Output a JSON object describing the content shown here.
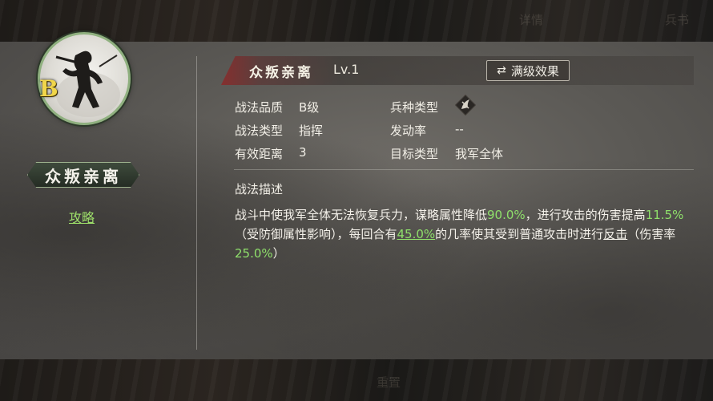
{
  "background": {
    "top_tab_left": "详情",
    "top_tab_right": "兵书",
    "bottom_hint": "重置"
  },
  "left": {
    "grade": "B",
    "skill_name_plate": "众叛亲离",
    "guide_link": "攻略"
  },
  "header": {
    "skill_name": "众叛亲离",
    "level": "Lv.1",
    "max_effect_button": "满级效果",
    "swap_icon": "⇄"
  },
  "attributes": {
    "quality_label": "战法品质",
    "quality_value": "B级",
    "type_label": "战法类型",
    "type_value": "指挥",
    "range_label": "有效距离",
    "range_value": "3",
    "troop_label": "兵种类型",
    "troop_icon": "troop-type-icon",
    "trigger_label": "发动率",
    "trigger_value": "--",
    "target_label": "目标类型",
    "target_value": "我军全体"
  },
  "description": {
    "heading": "战法描述",
    "part1": "战斗中使我军全体无法恢复兵力，谋略属性降低",
    "v1": "90.0%",
    "part2": "，进行攻击的伤害提高",
    "v2": "11.5%",
    "part3": "（受防御属性影响），每回合有",
    "v3": "45.0%",
    "part4": "的几率使其受到普通攻击时进行",
    "link": "反击",
    "part5": "（伤害率",
    "v4": "25.0%",
    "part6": "）"
  },
  "colors": {
    "accent_green": "#8fe06b",
    "grade_yellow": "#f1d64a",
    "title_red": "#8c2828"
  }
}
